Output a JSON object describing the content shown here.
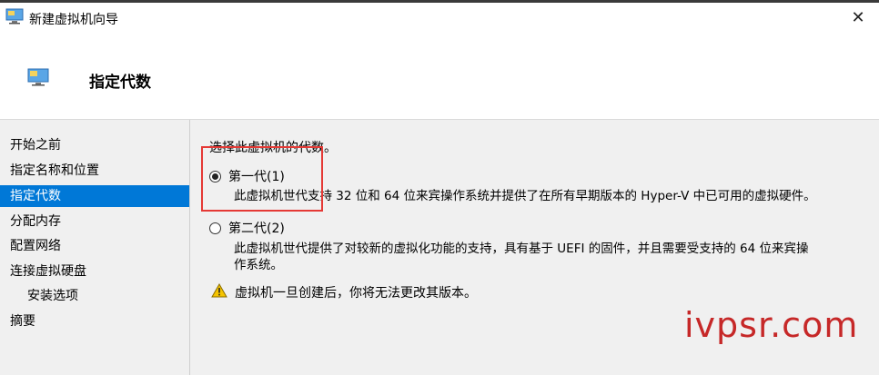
{
  "window": {
    "title": "新建虚拟机向导",
    "close_glyph": "✕"
  },
  "header": {
    "title": "指定代数"
  },
  "sidebar": {
    "items": [
      {
        "label": "开始之前"
      },
      {
        "label": "指定名称和位置"
      },
      {
        "label": "指定代数"
      },
      {
        "label": "分配内存"
      },
      {
        "label": "配置网络"
      },
      {
        "label": "连接虚拟硬盘"
      },
      {
        "label": "安装选项"
      },
      {
        "label": "摘要"
      }
    ],
    "active_index": 2
  },
  "main": {
    "prompt": "选择此虚拟机的代数。",
    "gen1": {
      "label": "第一代(1)",
      "checked": true,
      "desc": "此虚拟机世代支持 32 位和 64 位来宾操作系统并提供了在所有早期版本的 Hyper-V 中已可用的虚拟硬件。"
    },
    "gen2": {
      "label": "第二代(2)",
      "checked": false,
      "desc_line1": "此虚拟机世代提供了对较新的虚拟化功能的支持，具有基于 UEFI 的固件，并且需要受支持的 64 位来宾操",
      "desc_line2": "作系统。"
    },
    "warning": "虚拟机一旦创建后，你将无法更改其版本。"
  },
  "watermark": {
    "text": "ivpsr.com"
  },
  "colors": {
    "accent": "#0078d7",
    "highlight": "#e53935",
    "watermark": "#c62828",
    "panel": "#f0f0f0"
  },
  "icons": {
    "app": "monitor-icon",
    "warning": "warning-triangle-icon"
  }
}
